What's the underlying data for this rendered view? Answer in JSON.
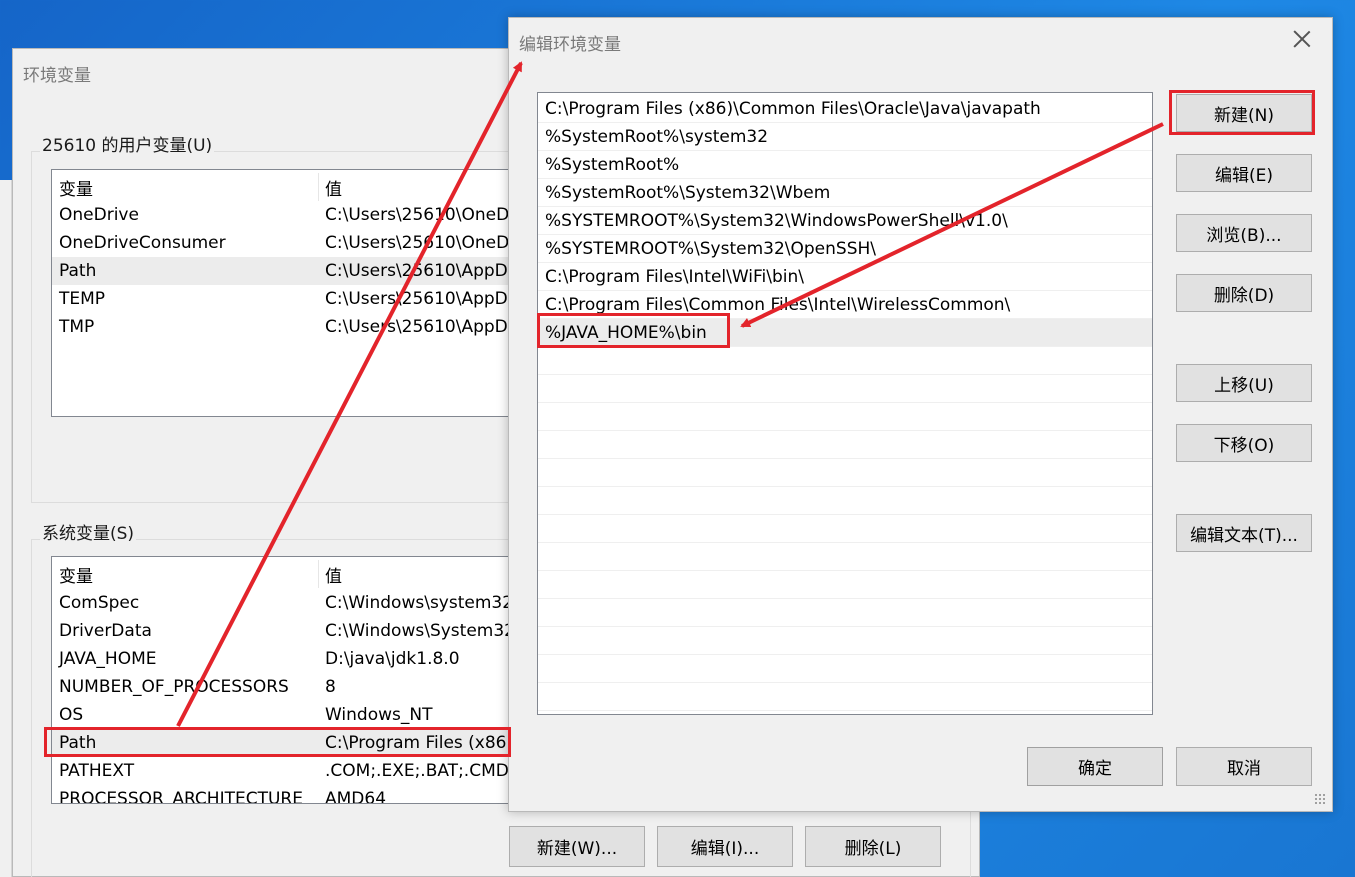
{
  "env_dialog": {
    "title": "环境变量",
    "user_vars_label": "25610 的用户变量(U)",
    "user_vars": {
      "headers": [
        "变量",
        "值"
      ],
      "rows": [
        [
          "OneDrive",
          "C:\\Users\\25610\\OneD"
        ],
        [
          "OneDriveConsumer",
          "C:\\Users\\25610\\OneD"
        ],
        [
          "Path",
          "C:\\Users\\25610\\AppD"
        ],
        [
          "TEMP",
          "C:\\Users\\25610\\AppD"
        ],
        [
          "TMP",
          "C:\\Users\\25610\\AppD"
        ]
      ]
    },
    "system_vars_label": "系统变量(S)",
    "system_vars": {
      "headers": [
        "变量",
        "值"
      ],
      "rows": [
        [
          "ComSpec",
          "C:\\Windows\\system32"
        ],
        [
          "DriverData",
          "C:\\Windows\\System32"
        ],
        [
          "JAVA_HOME",
          "D:\\java\\jdk1.8.0"
        ],
        [
          "NUMBER_OF_PROCESSORS",
          "8"
        ],
        [
          "OS",
          "Windows_NT"
        ],
        [
          "Path",
          "C:\\Program Files (x86"
        ],
        [
          "PATHEXT",
          ".COM;.EXE;.BAT;.CMD"
        ],
        [
          "PROCESSOR_ARCHITECTURE",
          "AMD64"
        ]
      ]
    },
    "system_buttons": {
      "new": "新建(W)...",
      "edit": "编辑(I)...",
      "delete": "删除(L)"
    }
  },
  "edit_dialog": {
    "title": "编辑环境变量",
    "paths": [
      "C:\\Program Files (x86)\\Common Files\\Oracle\\Java\\javapath",
      "%SystemRoot%\\system32",
      "%SystemRoot%",
      "%SystemRoot%\\System32\\Wbem",
      "%SYSTEMROOT%\\System32\\WindowsPowerShell\\v1.0\\",
      "%SYSTEMROOT%\\System32\\OpenSSH\\",
      "C:\\Program Files\\Intel\\WiFi\\bin\\",
      "C:\\Program Files\\Common Files\\Intel\\WirelessCommon\\",
      "%JAVA_HOME%\\bin"
    ],
    "buttons": {
      "new": "新建(N)",
      "edit": "编辑(E)",
      "browse": "浏览(B)...",
      "delete": "删除(D)",
      "move_up": "上移(U)",
      "move_down": "下移(O)",
      "edit_text": "编辑文本(T)...",
      "ok": "确定",
      "cancel": "取消"
    }
  },
  "colors": {
    "annotation_red": "#e3242b",
    "desktop_blue": "#1976d2",
    "selection_gray": "#ececec"
  }
}
